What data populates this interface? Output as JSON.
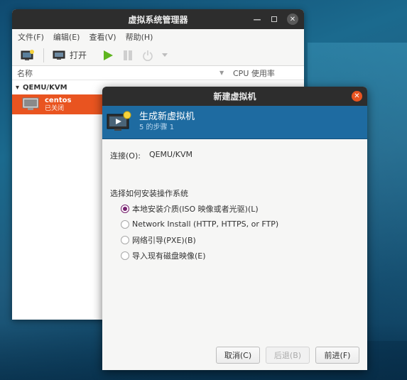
{
  "main_window": {
    "title": "虚拟系统管理器",
    "menu": [
      "文件(F)",
      "编辑(E)",
      "查看(V)",
      "帮助(H)"
    ],
    "toolbar": {
      "open_label": "打开"
    },
    "columns": {
      "name": "名称",
      "cpu": "CPU 使用率"
    },
    "group": {
      "label": "QEMU/KVM",
      "expander": "▾"
    },
    "vm": {
      "name": "centos",
      "state": "已关闭"
    }
  },
  "dialog": {
    "title": "新建虚拟机",
    "banner": {
      "title": "生成新虚拟机",
      "step": "5 的步骤 1"
    },
    "connection": {
      "label": "连接(O):",
      "value": "QEMU/KVM"
    },
    "section_label": "选择如何安装操作系统",
    "options": [
      {
        "label": "本地安装介质(ISO 映像或者光驱)(L)",
        "checked": true
      },
      {
        "label": "Network Install (HTTP, HTTPS, or FTP)",
        "checked": false
      },
      {
        "label": "网络引导(PXE)(B)",
        "checked": false
      },
      {
        "label": "导入现有磁盘映像(E)",
        "checked": false
      }
    ],
    "buttons": {
      "cancel": "取消(C)",
      "back": "后退(B)",
      "forward": "前进(F)"
    }
  },
  "colors": {
    "accent_orange": "#e95420",
    "banner_blue": "#1e6ba1",
    "radio_purple": "#77216f",
    "titlebar": "#2d2d2d"
  }
}
